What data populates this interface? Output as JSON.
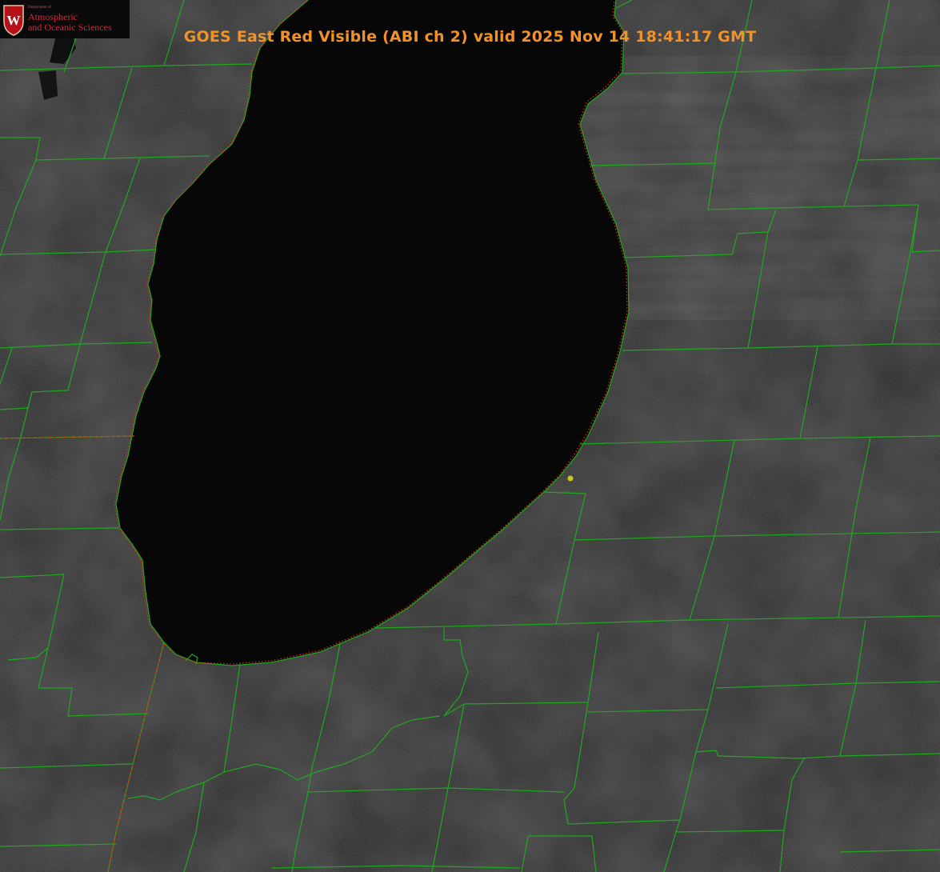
{
  "title": "GOES East Red Visible (ABI ch 2) valid 2025 Nov 14 18:41:17 GMT",
  "logo": {
    "department": "Department of",
    "line1": "Atmospheric",
    "line2": "and Oceanic Sciences",
    "crest_letter": "W"
  },
  "colors": {
    "title": "#f0922a",
    "county_lines": "#1fa81f",
    "state_lines": "#c2410c",
    "coastline_dots": "#e0261c",
    "station_marker": "#c8c81e",
    "land": "#1d1d1d",
    "lake": "#080808",
    "logo_text": "#d0263c"
  }
}
